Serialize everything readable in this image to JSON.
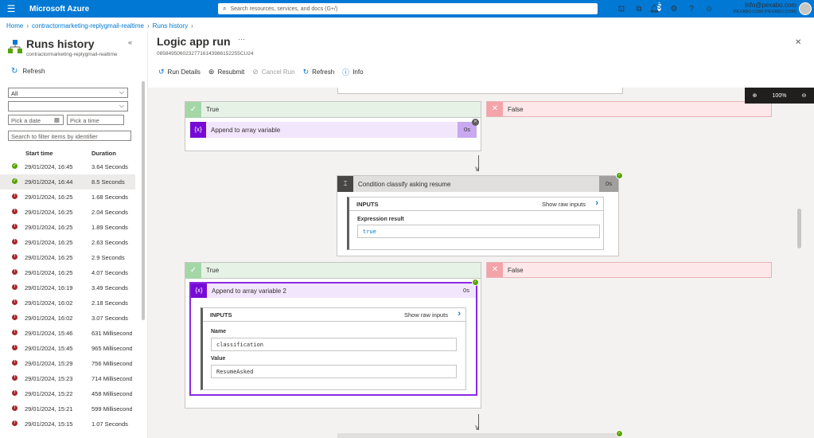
{
  "topbar": {
    "brand": "Microsoft Azure",
    "search_placeholder": "Search resources, services, and docs (G+/)",
    "notification_count": "5",
    "email": "Info@pexabo.com",
    "directory": "PEXABO.COM (PEXABO.COM)"
  },
  "breadcrumb": [
    "Home",
    "contractormarketing-replygmail-realtime",
    "Runs history"
  ],
  "left": {
    "title": "Runs history",
    "subtitle": "contractormarketing-replygmail-realtime",
    "refresh": "Refresh",
    "status_filter": "All",
    "date_placeholder": "Pick a date",
    "time_placeholder": "Pick a time",
    "filter_placeholder": "Search to filter items by identifier",
    "col_start": "Start time",
    "col_duration": "Duration",
    "runs": [
      {
        "status": "ok",
        "time": "29/01/2024, 16:45",
        "duration": "3.64 Seconds"
      },
      {
        "status": "ok",
        "time": "29/01/2024, 16:44",
        "duration": "8.5 Seconds"
      },
      {
        "status": "err",
        "time": "29/01/2024, 16:25",
        "duration": "1.68 Seconds"
      },
      {
        "status": "err",
        "time": "29/01/2024, 16:25",
        "duration": "2.04 Seconds"
      },
      {
        "status": "err",
        "time": "29/01/2024, 16:25",
        "duration": "1.89 Seconds"
      },
      {
        "status": "err",
        "time": "29/01/2024, 16:25",
        "duration": "2.63 Seconds"
      },
      {
        "status": "err",
        "time": "29/01/2024, 16:25",
        "duration": "2.9 Seconds"
      },
      {
        "status": "err",
        "time": "29/01/2024, 16:25",
        "duration": "4.07 Seconds"
      },
      {
        "status": "err",
        "time": "29/01/2024, 16:19",
        "duration": "3.49 Seconds"
      },
      {
        "status": "err",
        "time": "29/01/2024, 16:02",
        "duration": "2.18 Seconds"
      },
      {
        "status": "err",
        "time": "29/01/2024, 16:02",
        "duration": "3.07 Seconds"
      },
      {
        "status": "err",
        "time": "29/01/2024, 15:46",
        "duration": "631 Milliseconds"
      },
      {
        "status": "err",
        "time": "29/01/2024, 15:45",
        "duration": "965 Milliseconds"
      },
      {
        "status": "err",
        "time": "29/01/2024, 15:29",
        "duration": "756 Milliseconds"
      },
      {
        "status": "err",
        "time": "29/01/2024, 15:23",
        "duration": "714 Milliseconds"
      },
      {
        "status": "err",
        "time": "29/01/2024, 15:22",
        "duration": "458 Milliseconds"
      },
      {
        "status": "err",
        "time": "29/01/2024, 15:21",
        "duration": "599 Milliseconds"
      },
      {
        "status": "err",
        "time": "29/01/2024, 15:15",
        "duration": "1.07 Seconds"
      }
    ],
    "selected_index": 1
  },
  "main": {
    "title": "Logic app run",
    "run_id": "08584950602327716143986152255CU24",
    "toolbar": {
      "run_details": "Run Details",
      "resubmit": "Resubmit",
      "cancel_run": "Cancel Run",
      "refresh": "Refresh",
      "info": "Info"
    },
    "zoom": "100%"
  },
  "flow": {
    "true_label": "True",
    "false_label": "False",
    "action1": {
      "name": "Append to array variable",
      "duration": "0s"
    },
    "condition": {
      "name": "Condition classify asking resume",
      "duration": "0s",
      "inputs": "INPUTS",
      "show_raw": "Show raw inputs",
      "expr_label": "Expression result",
      "expr_value": "true"
    },
    "action2": {
      "name": "Append to array variable 2",
      "duration": "0s",
      "inputs": "INPUTS",
      "show_raw": "Show raw inputs",
      "name_label": "Name",
      "name_value": "classification",
      "value_label": "Value",
      "value_value": "ResumeAsked"
    }
  }
}
